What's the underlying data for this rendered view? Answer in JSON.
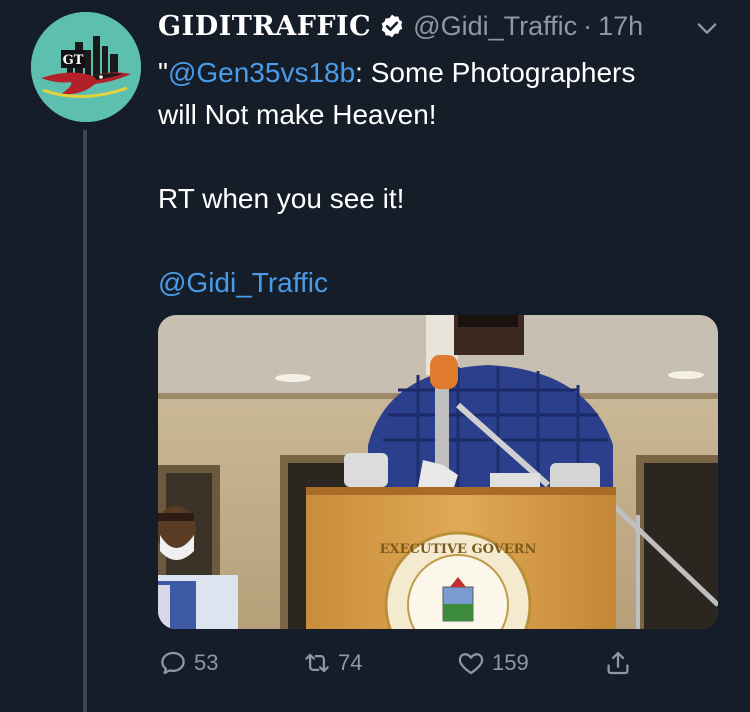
{
  "tweet": {
    "display_name": "GIDITRAFFIC",
    "handle": "@Gidi_Traffic",
    "separator": "·",
    "time": "17h",
    "text_quote_open": "\"",
    "mention": "@Gen35vs18b",
    "text_line1_rest": ": Some Photographers",
    "text_line2": "will Not make Heaven!",
    "text_line3": "RT when you see it!",
    "signature_link": "@Gidi_Traffic"
  },
  "media": {
    "seal_text": "EXECUTIVE GOVERN"
  },
  "actions": {
    "replies": "53",
    "retweets": "74",
    "likes": "159"
  },
  "icons": [
    "verified-icon",
    "chevron-down-icon",
    "reply-icon",
    "retweet-icon",
    "like-icon",
    "share-icon"
  ],
  "colors": {
    "background": "#151d28",
    "link": "#4a9ce8",
    "muted": "#8c98a6"
  }
}
